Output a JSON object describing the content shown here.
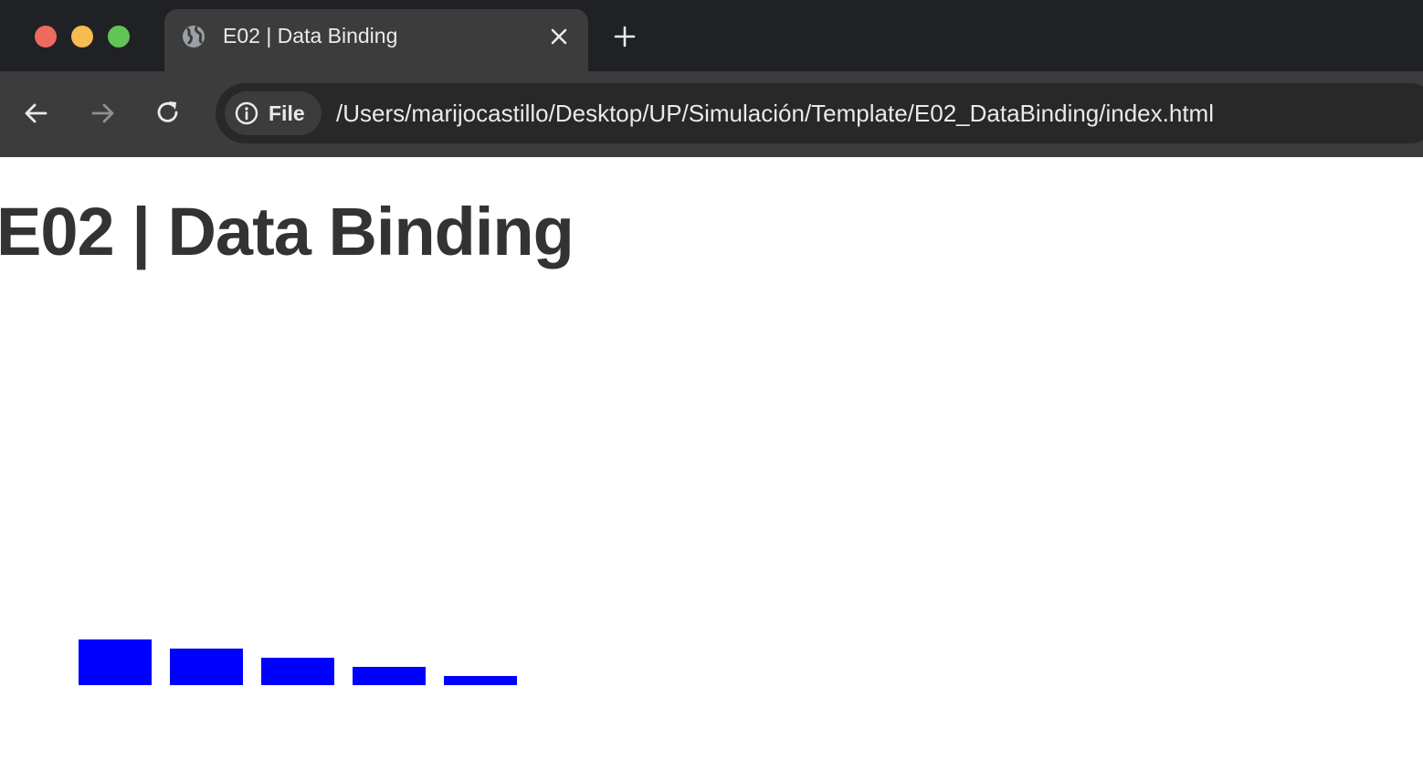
{
  "browser": {
    "tab": {
      "title": "E02 | Data Binding",
      "favicon": "globe-icon"
    },
    "address_bar": {
      "scheme_chip": "File",
      "url": "/Users/marijocastillo/Desktop/UP/Simulación/Template/E02_DataBinding/index.html"
    },
    "icons": {
      "close_tab": "close-icon",
      "new_tab": "plus-icon",
      "back": "arrow-left-icon",
      "forward": "arrow-right-icon",
      "reload": "reload-icon",
      "info": "info-icon"
    },
    "colors": {
      "traffic_close": "#ee6a5f",
      "traffic_minimize": "#f5bd4f",
      "traffic_maximize": "#61c454"
    }
  },
  "page": {
    "title": "E02 | Data Binding"
  },
  "chart_data": {
    "type": "bar",
    "values": [
      5,
      4,
      3,
      2,
      1
    ],
    "bar_color": "#0000ff",
    "title": "",
    "xlabel": "",
    "ylabel": ""
  }
}
